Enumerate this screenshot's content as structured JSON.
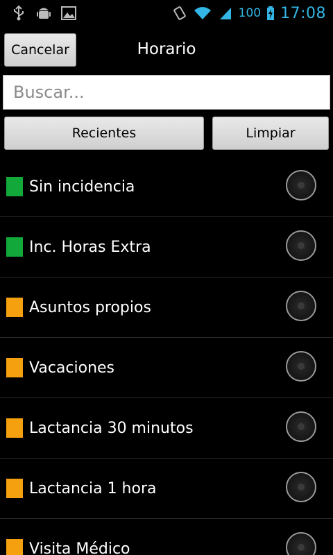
{
  "status_bar": {
    "battery": "100",
    "time": "17:08",
    "accent_color": "#33b5e5",
    "icons": [
      "usb-icon",
      "android-debug-icon",
      "image-icon",
      "vibrate-icon",
      "wifi-icon",
      "signal-icon",
      "battery-charging-icon"
    ]
  },
  "header": {
    "cancel_label": "Cancelar",
    "title": "Horario"
  },
  "search": {
    "placeholder": "Buscar...",
    "value": ""
  },
  "actions": {
    "recent_label": "Recientes",
    "clear_label": "Limpiar"
  },
  "list": {
    "items": [
      {
        "label": "Sin incidencia",
        "color": "#12a83a"
      },
      {
        "label": "Inc. Horas Extra",
        "color": "#12a83a"
      },
      {
        "label": "Asuntos propios",
        "color": "#f5a00e"
      },
      {
        "label": "Vacaciones",
        "color": "#f5a00e"
      },
      {
        "label": "Lactancia 30 minutos",
        "color": "#f5a00e"
      },
      {
        "label": "Lactancia 1 hora",
        "color": "#f5a00e"
      },
      {
        "label": "Visita Médico",
        "color": "#f5a00e"
      }
    ]
  }
}
